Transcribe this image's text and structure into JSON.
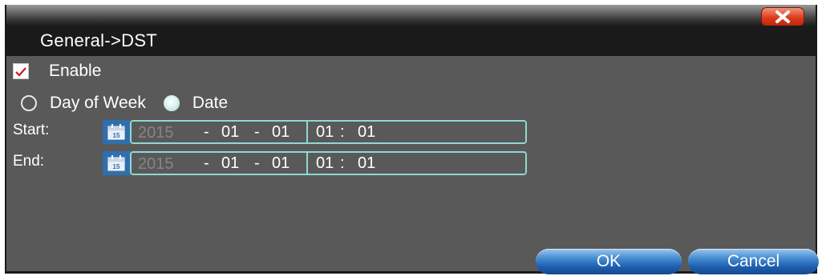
{
  "dialog": {
    "header_title": "General->DST",
    "close_icon": "close-icon"
  },
  "enable": {
    "label": "Enable",
    "checked": true
  },
  "dst_mode": {
    "options": [
      "Day of Week",
      "Date"
    ],
    "selected": "Date"
  },
  "start": {
    "label": "Start:",
    "year": "2015",
    "month": "01",
    "day": "01",
    "hour": "01",
    "minute": "01",
    "sep_date": "-",
    "sep_time": ":",
    "icon": "calendar-icon"
  },
  "end": {
    "label": "End:",
    "year": "2015",
    "month": "01",
    "day": "01",
    "hour": "01",
    "minute": "01",
    "sep_date": "-",
    "sep_time": ":",
    "icon": "calendar-icon"
  },
  "buttons": {
    "ok": "OK",
    "cancel": "Cancel"
  },
  "colors": {
    "panel_bg": "#595959",
    "field_border": "#8fd9d2",
    "close_red": "#de3a1a",
    "button_blue": "#1e5fb0"
  }
}
